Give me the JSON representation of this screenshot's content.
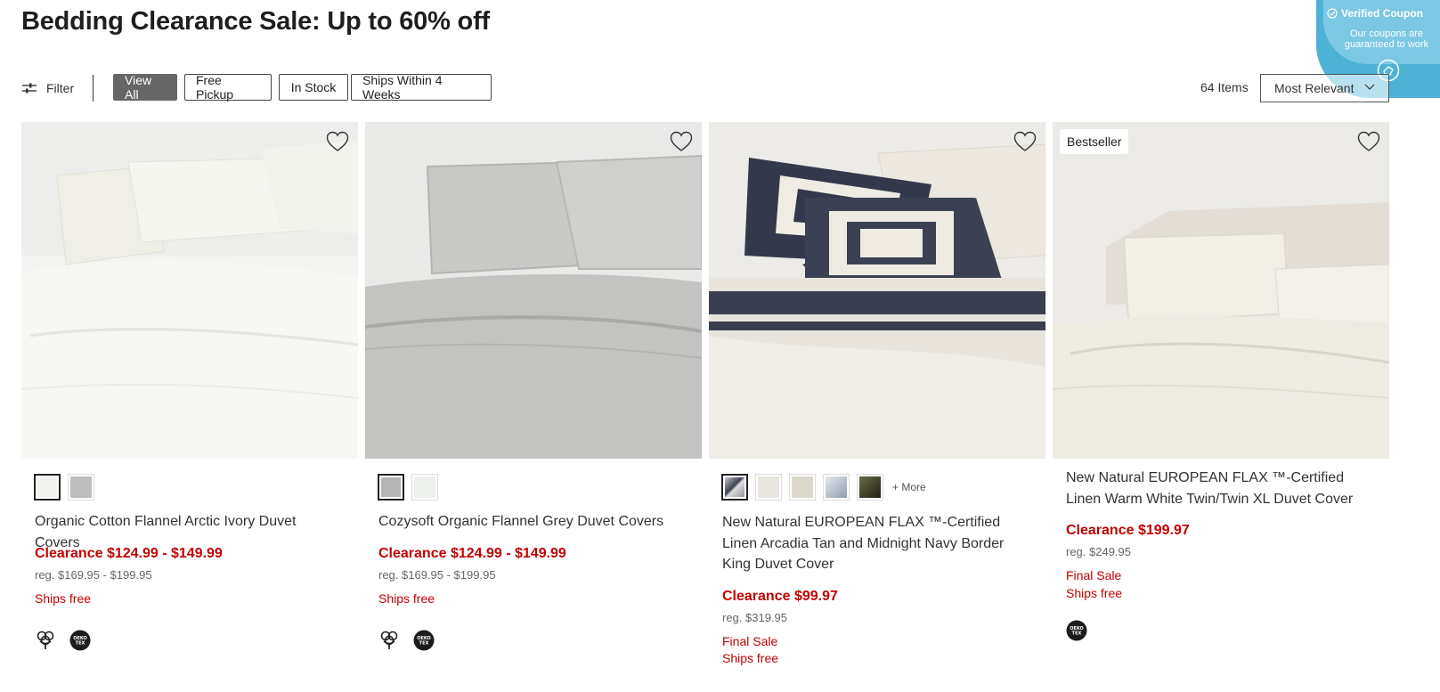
{
  "page_title": "Bedding Clearance Sale: Up to 60% off",
  "coupon": {
    "title": "Verified Coupon",
    "subtitle": "Our coupons are guaranteed to work"
  },
  "toolbar": {
    "filter_label": "Filter",
    "chips": [
      "View All",
      "Free Pickup",
      "In Stock",
      "Ships Within 4 Weeks"
    ],
    "active_chip": "View All",
    "item_count": "64 Items",
    "sort_label": "Most Relevant"
  },
  "products": [
    {
      "name": "Organic Cotton Flannel Arctic Ivory Duvet Covers",
      "price": "Clearance $124.99 - $149.99",
      "reg": "reg. $169.95 - $199.95",
      "notes": [
        "Ships free"
      ],
      "swatches": [
        "#f1f1ee",
        "#bdbdbd"
      ],
      "selected_swatch": 0,
      "icons": [
        "cotton-icon",
        "oeko-tex-icon"
      ]
    },
    {
      "name": "Cozysoft Organic Flannel Grey Duvet Covers",
      "price": "Clearance $124.99 - $149.99",
      "reg": "reg. $169.95 - $199.95",
      "notes": [
        "Ships free"
      ],
      "swatches": [
        "#b5b5b5",
        "#eef0ed"
      ],
      "selected_swatch": 0,
      "icons": [
        "cotton-icon",
        "oeko-tex-icon"
      ]
    },
    {
      "name": "New Natural EUROPEAN FLAX ™-Certified Linen Arcadia Tan and Midnight Navy Border King Duvet Cover",
      "price": "Clearance $99.97",
      "reg": "reg. $319.95",
      "notes": [
        "Final Sale",
        "Ships free"
      ],
      "swatches": [
        "#8e929c",
        "#e9e6df",
        "#dcd8cc",
        "#a9b3c2",
        "#3a3a2a"
      ],
      "selected_swatch": 0,
      "more_label": "+ More",
      "icons": []
    },
    {
      "badge": "Bestseller",
      "name": "New Natural EUROPEAN FLAX ™-Certified Linen Warm White Twin/Twin XL Duvet Cover",
      "price": "Clearance $199.97",
      "reg": "reg. $249.95",
      "notes": [
        "Final Sale",
        "Ships free"
      ],
      "swatches": [],
      "icons": [
        "oeko-tex-icon"
      ]
    }
  ],
  "colors": {
    "clearance_red": "#c20000",
    "coupon_blue": "#4db3d6",
    "chip_active": "#666666"
  }
}
